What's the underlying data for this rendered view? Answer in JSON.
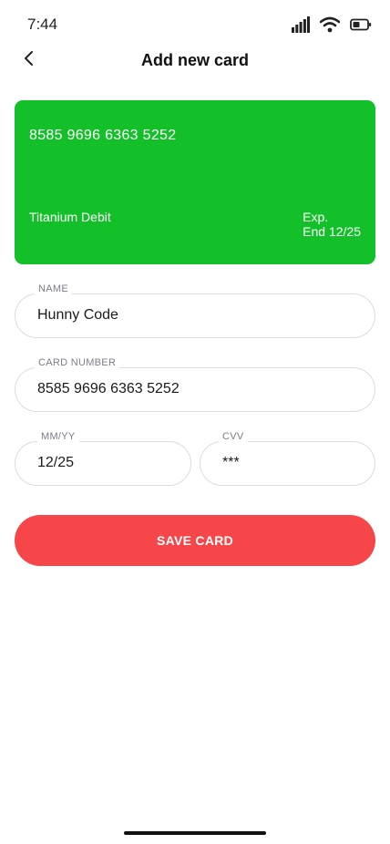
{
  "status_bar": {
    "time": "7:44"
  },
  "header": {
    "title": "Add new card"
  },
  "card": {
    "number": "8585 9696 6363 5252",
    "type": "Titanium Debit",
    "exp_label": "Exp.",
    "exp_value": "End 12/25",
    "color": "#13c02a"
  },
  "form": {
    "name": {
      "label": "NAME",
      "value": "Hunny Code"
    },
    "card_number": {
      "label": "CARD NUMBER",
      "value": "8585 9696 6363 5252"
    },
    "expiry": {
      "label": "MM/YY",
      "value": "12/25"
    },
    "cvv": {
      "label": "CVV",
      "value": "***"
    }
  },
  "actions": {
    "save_label": "SAVE CARD",
    "save_color": "#f7464a"
  },
  "icons": {
    "back": "chevron-left-icon",
    "signal": "signal-icon",
    "wifi": "wifi-icon",
    "battery": "battery-icon"
  }
}
